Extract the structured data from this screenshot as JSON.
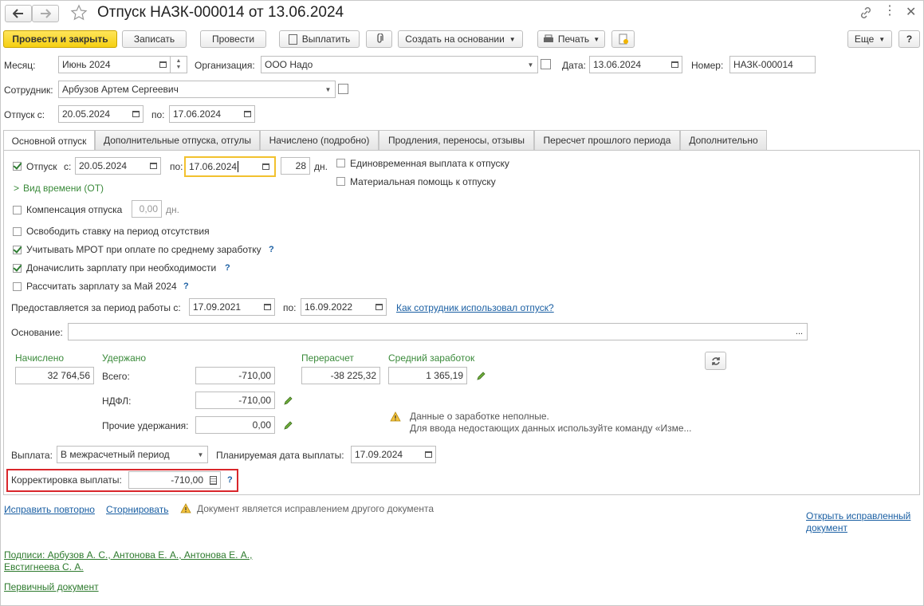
{
  "header": {
    "title": "Отпуск НАЗК-000014 от 13.06.2024"
  },
  "toolbar": {
    "post_close": "Провести и закрыть",
    "save": "Записать",
    "post": "Провести",
    "pay": "Выплатить",
    "create_based": "Создать на основании",
    "print": "Печать",
    "more": "Еще",
    "help": "?"
  },
  "fields": {
    "month_label": "Месяц:",
    "month_value": "Июнь 2024",
    "org_label": "Организация:",
    "org_value": "ООО Надо",
    "date_label": "Дата:",
    "date_value": "13.06.2024",
    "number_label": "Номер:",
    "number_value": "НАЗК-000014",
    "employee_label": "Сотрудник:",
    "employee_value": "Арбузов Артем Сергеевич",
    "leave_from_label": "Отпуск с:",
    "leave_from_value": "20.05.2024",
    "leave_to_label": "по:",
    "leave_to_value": "17.06.2024"
  },
  "tabs": [
    {
      "label": "Основной отпуск"
    },
    {
      "label": "Дополнительные отпуска, отгулы"
    },
    {
      "label": "Начислено (подробно)"
    },
    {
      "label": "Продления, переносы, отзывы"
    },
    {
      "label": "Пересчет прошлого периода"
    },
    {
      "label": "Дополнительно"
    }
  ],
  "main": {
    "vacation_label": "Отпуск",
    "vacation_from_label": "с:",
    "vacation_from": "20.05.2024",
    "vacation_to_label": "по:",
    "vacation_to": "17.06.2024",
    "days": "28",
    "days_unit": "дн.",
    "one_time_payment": "Единовременная выплата к отпуску",
    "material_aid": "Материальная помощь к отпуску",
    "time_type": "Вид времени (ОТ)",
    "compensation_label": "Компенсация отпуска",
    "compensation_value": "0,00",
    "compensation_unit": "дн.",
    "free_rate": "Освободить ставку на период отсутствия",
    "consider_mrot": "Учитывать МРОТ при оплате по среднему заработку",
    "add_salary": "Доначислить зарплату при необходимости",
    "calc_salary": "Рассчитать зарплату за Май 2024",
    "q": "?",
    "period_label": "Предоставляется за период работы с:",
    "period_from": "17.09.2021",
    "period_to_label": "по:",
    "period_to": "16.09.2022",
    "used_link": "Как сотрудник использовал отпуск?",
    "basis_label": "Основание:",
    "basis_value": "",
    "basis_btn": "..."
  },
  "totals": {
    "accrued_label": "Начислено",
    "accrued_value": "32 764,56",
    "withheld_label": "Удержано",
    "total_label": "Всего:",
    "total_value": "-710,00",
    "ndfl_label": "НДФЛ:",
    "ndfl_value": "-710,00",
    "other_label": "Прочие удержания:",
    "other_value": "0,00",
    "recalc_label": "Перерасчет",
    "recalc_value": "-38 225,32",
    "avg_label": "Средний заработок",
    "avg_value": "1 365,19",
    "warning_line1": "Данные о заработке неполные.",
    "warning_line2": "Для ввода недостающих данных используйте команду «Изме..."
  },
  "payment": {
    "label": "Выплата:",
    "value": "В межрасчетный период",
    "planned_label": "Планируемая дата выплаты:",
    "planned_value": "17.09.2024",
    "correction_label": "Корректировка выплаты:",
    "correction_value": "-710,00"
  },
  "footer": {
    "fix_again": "Исправить повторно",
    "reverse": "Сторнировать",
    "correction_note": "Документ является исправлением другого документа",
    "open_fixed_1": "Открыть исправленный",
    "open_fixed_2": "документ",
    "signatures_1": "Подписи: Арбузов А. С., Антонова Е. А., Антонова Е. А.,",
    "signatures_2": "Евстигнеева С. А.",
    "primary_doc": "Первичный документ"
  },
  "colors": {
    "accent_yellow": "#f5cf12",
    "green_text": "#3a8a3a",
    "link_blue": "#1a5fa3",
    "highlight_red": "#d9262b"
  }
}
